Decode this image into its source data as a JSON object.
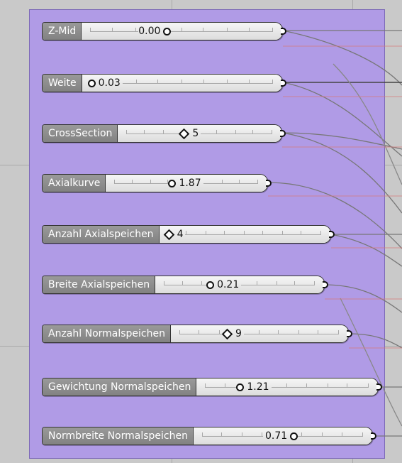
{
  "sliders": [
    {
      "label": "Z-Mid",
      "value": "0.00",
      "knob": "circle",
      "value_first": true
    },
    {
      "label": "Weite",
      "value": "0.03",
      "knob": "circle",
      "value_first": false
    },
    {
      "label": "CrossSection",
      "value": "5",
      "knob": "diamond",
      "value_first": false
    },
    {
      "label": "Axialkurve",
      "value": "1.87",
      "knob": "circle",
      "value_first": false
    },
    {
      "label": "Anzahl Axialspeichen",
      "value": "4",
      "knob": "diamond",
      "value_first": false
    },
    {
      "label": "Breite Axialspeichen",
      "value": "0.21",
      "knob": "circle",
      "value_first": false
    },
    {
      "label": "Anzahl Normalspeichen",
      "value": "9",
      "knob": "diamond",
      "value_first": false
    },
    {
      "label": "Gewichtung Normalspeichen",
      "value": "1.21",
      "knob": "circle",
      "value_first": false
    },
    {
      "label": "Normbreite Normalspeichen",
      "value": "0.71",
      "knob": "circle",
      "value_first": true
    }
  ],
  "colors": {
    "group_fill": "#b09be6",
    "canvas": "#c9c9c9",
    "wire": "#5a5a5a"
  }
}
